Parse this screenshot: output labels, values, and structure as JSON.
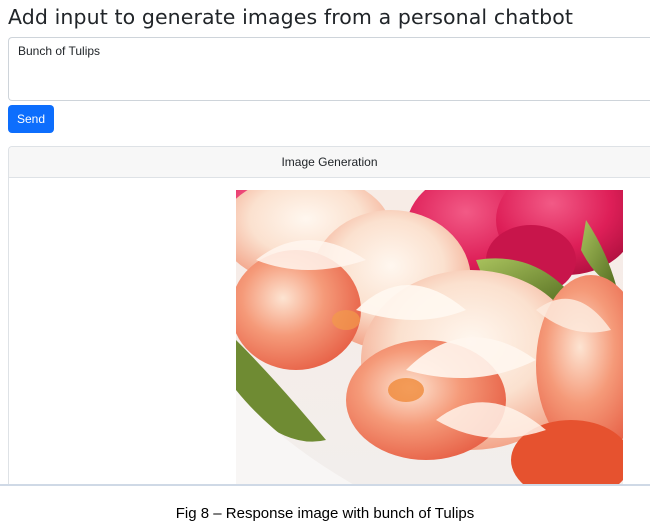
{
  "header": {
    "title": "Add input to generate images from a personal chatbot"
  },
  "prompt": {
    "value": "Bunch of Tulips",
    "placeholder": ""
  },
  "actions": {
    "send_label": "Send"
  },
  "result_card": {
    "header_label": "Image Generation",
    "image_icon": "tulip-bouquet-image"
  },
  "figure": {
    "caption": "Fig 8 – Response image with bunch of Tulips"
  },
  "colors": {
    "primary_button": "#0d6efd",
    "card_header_bg": "#f7f7f7",
    "border": "#dee2e6",
    "tulip_pink": "#e2245c",
    "tulip_peach": "#f6c9ad",
    "leaf_green": "#7c9a3a"
  }
}
